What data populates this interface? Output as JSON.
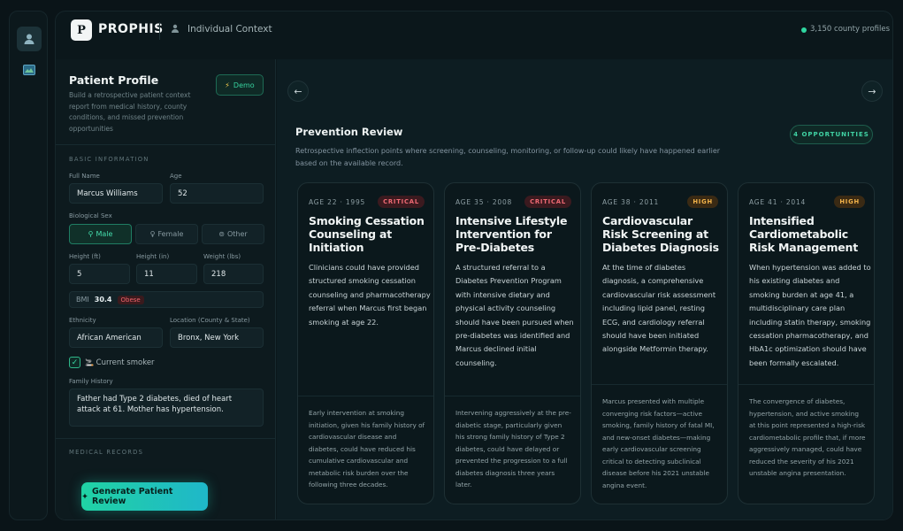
{
  "app": {
    "logo_letter": "P",
    "brand": "PROPHIS",
    "context_label": "Individual Context",
    "county_profiles": "3,150 county profiles"
  },
  "rail": {
    "item1_icon": "user-icon",
    "item2_icon": "map-icon"
  },
  "patient": {
    "title": "Patient Profile",
    "description": "Build a retrospective patient context report from medical history, county conditions, and missed prevention opportunities",
    "demo_label": "Demo",
    "basic_info_header": "BASIC INFORMATION",
    "full_name_label": "Full Name",
    "full_name": "Marcus Williams",
    "age_label": "Age",
    "age": "52",
    "sex_label": "Biological Sex",
    "sex_options": [
      "Male",
      "Female",
      "Other"
    ],
    "sex_selected": "Male",
    "height_ft_label": "Height (ft)",
    "height_ft": "5",
    "height_in_label": "Height (in)",
    "height_in": "11",
    "weight_label": "Weight (lbs)",
    "weight": "218",
    "bmi_label": "BMI",
    "bmi_value": "30.4",
    "bmi_class": "Obese",
    "ethnicity_label": "Ethnicity",
    "ethnicity": "African American",
    "location_label": "Location (County & State)",
    "location": "Bronx, New York",
    "smoker_label": "Current smoker",
    "smoker_checked": true,
    "family_history_label": "Family History",
    "family_history": "Father had Type 2 diabetes, died of heart attack at 61. Mother has hypertension.",
    "medical_records_header": "MEDICAL RECORDS",
    "generate_label": "Generate Patient Review"
  },
  "review": {
    "title": "Prevention Review",
    "subtitle": "Retrospective inflection points where screening, counseling, monitoring, or follow-up could likely have happened earlier based on the available record.",
    "opportunities_badge": "4 OPPORTUNITIES",
    "cards": [
      {
        "meta": "AGE 22 · 1995",
        "severity": "CRITICAL",
        "title": "Smoking Cessation Counseling at Initiation",
        "body": "Clinicians could have provided structured smoking cessation counseling and pharmacotherapy referral when Marcus first began smoking at age 22.",
        "footer": "Early intervention at smoking initiation, given his family history of cardiovascular disease and diabetes, could have reduced his cumulative cardiovascular and metabolic risk burden over the following three decades."
      },
      {
        "meta": "AGE 35 · 2008",
        "severity": "CRITICAL",
        "title": "Intensive Lifestyle Intervention for Pre-Diabetes",
        "body": "A structured referral to a Diabetes Prevention Program with intensive dietary and physical activity counseling should have been pursued when pre-diabetes was identified and Marcus declined initial counseling.",
        "footer": "Intervening aggressively at the pre-diabetic stage, particularly given his strong family history of Type 2 diabetes, could have delayed or prevented the progression to a full diabetes diagnosis three years later."
      },
      {
        "meta": "AGE 38 · 2011",
        "severity": "HIGH",
        "title": "Cardiovascular Risk Screening at Diabetes Diagnosis",
        "body": "At the time of diabetes diagnosis, a comprehensive cardiovascular risk assessment including lipid panel, resting ECG, and cardiology referral should have been initiated alongside Metformin therapy.",
        "footer": "Marcus presented with multiple converging risk factors—active smoking, family history of fatal MI, and new-onset diabetes—making early cardiovascular screening critical to detecting subclinical disease before his 2021 unstable angina event."
      },
      {
        "meta": "AGE 41 · 2014",
        "severity": "HIGH",
        "title": "Intensified Cardiometabolic Risk Management",
        "body": "When hypertension was added to his existing diabetes and smoking burden at age 41, a multidisciplinary care plan including statin therapy, smoking cessation pharmacotherapy, and HbA1c optimization should have been formally escalated.",
        "footer": "The convergence of diabetes, hypertension, and active smoking at this point represented a high-risk cardiometabolic profile that, if more aggressively managed, could have reduced the severity of his 2021 unstable angina presentation."
      }
    ]
  },
  "colors": {
    "accent": "#2fd6a0",
    "critical": "#f06a74",
    "high": "#f2b34a",
    "background": "#0a1418"
  }
}
